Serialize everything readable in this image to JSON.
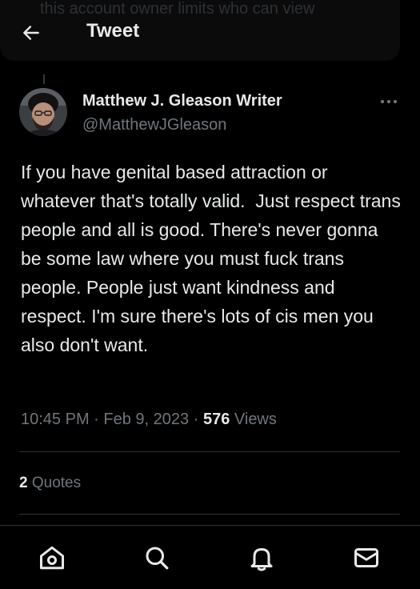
{
  "banner": {
    "text": "this account owner limits who can view"
  },
  "header": {
    "title": "Tweet"
  },
  "tweet": {
    "author": {
      "display_name": "Matthew J. Gleason Writer",
      "handle": "@MatthewJGleason"
    },
    "text": "If you have genital based attraction or whatever that's totally valid.  Just respect trans people and all is good. There's never gonna be some law where you must fuck trans people. People just want kindness and respect. I'm sure there's lots of cis men you also don't want.",
    "time": "10:45 PM",
    "date": "Feb 9, 2023",
    "separator": "·",
    "views_count": "576",
    "views_label": "Views",
    "quotes_count": "2",
    "quotes_label": "Quotes"
  },
  "nav": {
    "items": [
      {
        "icon": "home-icon"
      },
      {
        "icon": "search-icon"
      },
      {
        "icon": "bell-icon"
      },
      {
        "icon": "mail-icon"
      }
    ]
  },
  "colors": {
    "background": "#000000",
    "text_primary": "#e7e9ea",
    "text_secondary": "#71767b",
    "divider": "#2f3336"
  }
}
